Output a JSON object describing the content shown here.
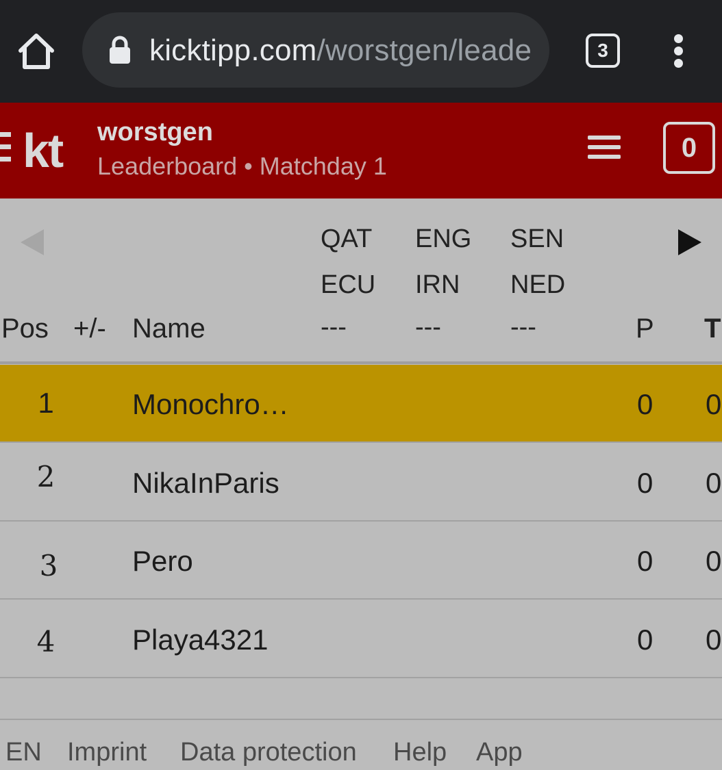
{
  "browser": {
    "url_host": "kicktipp.com",
    "url_path": "/worstgen/leade",
    "tab_count": "3"
  },
  "app": {
    "logo": "kt",
    "group_name": "worstgen",
    "subtitle": "Leaderboard • Matchday 1",
    "cart_count": "0"
  },
  "table": {
    "matches": [
      {
        "home": "QAT",
        "away": "ECU",
        "score": "---"
      },
      {
        "home": "ENG",
        "away": "IRN",
        "score": "---"
      },
      {
        "home": "SEN",
        "away": "NED",
        "score": "---"
      }
    ],
    "headers": {
      "pos": "Pos",
      "change": "+/-",
      "name": "Name",
      "points": "P",
      "total": "T"
    },
    "rows": [
      {
        "pos": "1",
        "name": "Monochro…",
        "points": "0",
        "total": "0"
      },
      {
        "pos": "2",
        "name": "NikaInParis",
        "points": "0",
        "total": "0"
      },
      {
        "pos": "3",
        "name": "Pero",
        "points": "0",
        "total": "0"
      },
      {
        "pos": "4",
        "name": "Playa4321",
        "points": "0",
        "total": "0"
      }
    ]
  },
  "footer": {
    "links": [
      "EN",
      "Imprint",
      "Data protection",
      "Help",
      "App"
    ]
  },
  "colors": {
    "chrome": "#202124",
    "header": "#8d0000",
    "highlight_row": "#bb9300",
    "page": "#bcbcbc"
  }
}
